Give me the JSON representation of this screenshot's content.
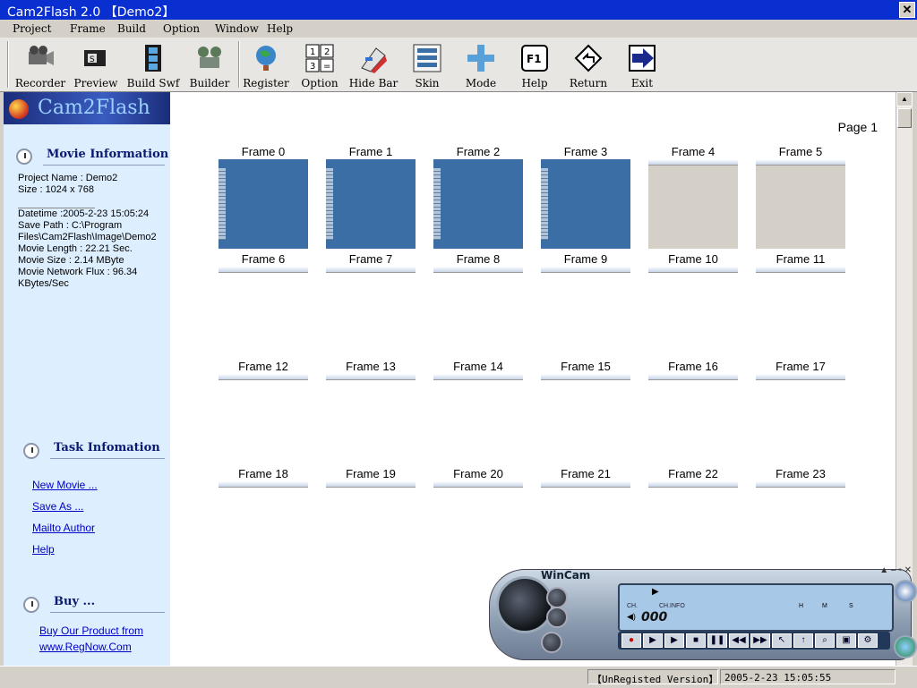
{
  "window": {
    "title": "Cam2Flash 2.0  【Demo2】",
    "close_glyph": "✕"
  },
  "menu": [
    "Project",
    "Frame",
    "Build",
    "Option",
    "Window",
    "Help"
  ],
  "toolbar": [
    {
      "label": "Recorder",
      "icon": "recorder-icon"
    },
    {
      "label": "Preview",
      "icon": "preview-icon"
    },
    {
      "label": "Build Swf",
      "icon": "film-icon"
    },
    {
      "label": "Builder",
      "icon": "builder-icon"
    },
    {
      "label": "Register",
      "icon": "globe-icon"
    },
    {
      "label": "Option",
      "icon": "option-icon"
    },
    {
      "label": "Hide Bar",
      "icon": "hide-bar-icon"
    },
    {
      "label": "Skin",
      "icon": "skin-icon"
    },
    {
      "label": "Mode",
      "icon": "mode-icon"
    },
    {
      "label": "Help",
      "icon": "help-f1-icon"
    },
    {
      "label": "Return",
      "icon": "return-icon"
    },
    {
      "label": "Exit",
      "icon": "exit-icon"
    }
  ],
  "sidebar": {
    "logo_text": "Cam2Flash",
    "movie_info": {
      "heading": "Movie Information",
      "project_name": "Project Name : Demo2",
      "size": "Size : 1024 x 768",
      "datetime": "Datetime :2005-2-23 15:05:24",
      "save_path": "Save Path : C:\\Program Files\\Cam2Flash\\Image\\Demo2",
      "movie_length": "Movie Length : 22.21 Sec.",
      "movie_size": "Movie Size : 2.14 MByte",
      "network_flux": "Movie Network Flux : 96.34 KBytes/Sec"
    },
    "task_info": {
      "heading": "Task Infomation",
      "links": [
        "New Movie ...",
        "Save As ...",
        "Mailto Author",
        "Help"
      ]
    },
    "buy": {
      "heading": "Buy ...",
      "link_line1": "Buy Our Product from",
      "link_line2": "www.RegNow.Com"
    }
  },
  "main": {
    "page_label": "Page 1",
    "frames": [
      "Frame 0",
      "Frame 1",
      "Frame 2",
      "Frame 3",
      "Frame 4",
      "Frame 5",
      "Frame 6",
      "Frame 7",
      "Frame 8",
      "Frame 9",
      "Frame 10",
      "Frame 11",
      "Frame 12",
      "Frame 13",
      "Frame 14",
      "Frame 15",
      "Frame 16",
      "Frame 17",
      "Frame 18",
      "Frame 19",
      "Frame 20",
      "Frame 21",
      "Frame 22",
      "Frame 23"
    ]
  },
  "wincam": {
    "title": "WinCam",
    "counter": "000",
    "ch_label": "CH.",
    "ch_info": "CH.INFO",
    "cols": [
      "H",
      "M",
      "S"
    ]
  },
  "status": {
    "registration": "【UnRegisted Version】",
    "datetime": "2005-2-23 15:05:55"
  }
}
